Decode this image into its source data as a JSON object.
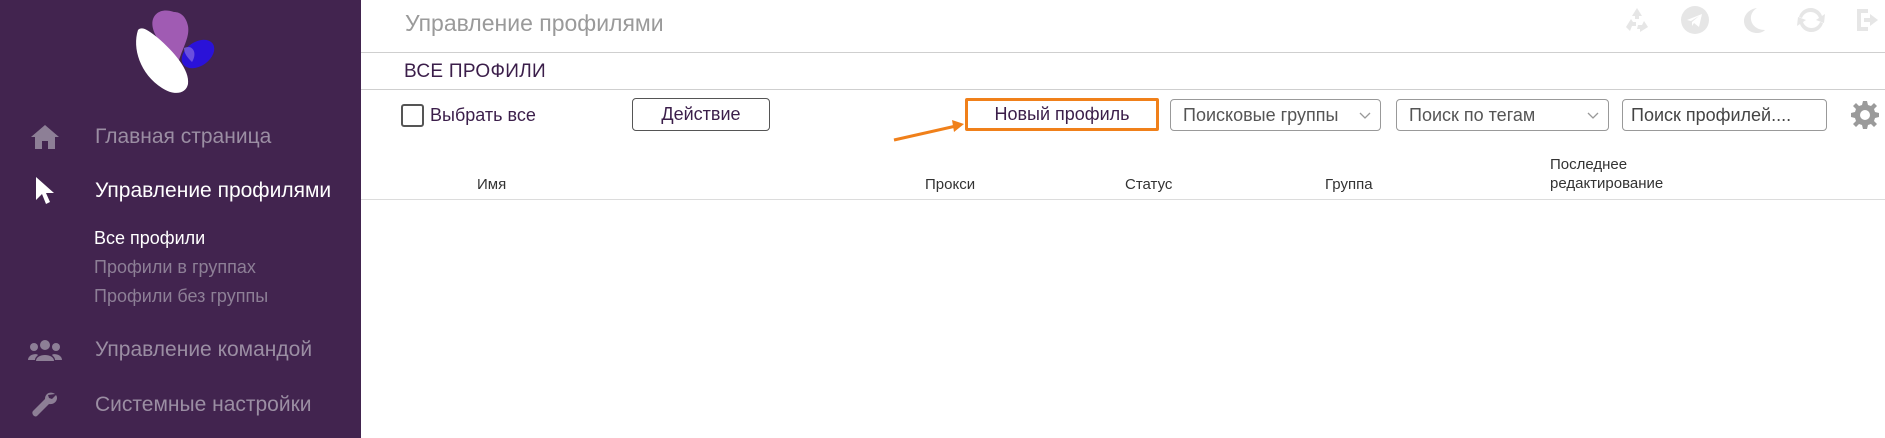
{
  "sidebar": {
    "nav": [
      {
        "label": "Главная страница",
        "icon": "home-icon",
        "active": false
      },
      {
        "label": "Управление профилями",
        "icon": "cursor-icon",
        "active": true
      },
      {
        "label": "Управление командой",
        "icon": "users-icon",
        "active": false
      },
      {
        "label": "Системные настройки",
        "icon": "wrench-icon",
        "active": false
      }
    ],
    "sub_items": [
      {
        "label": "Все профили",
        "active": true
      },
      {
        "label": "Профили в группах",
        "active": false
      },
      {
        "label": "Профили без группы",
        "active": false
      }
    ]
  },
  "header": {
    "title": "Управление профилями",
    "icons": [
      "recycle-icon",
      "telegram-icon",
      "moon-icon",
      "refresh-icon",
      "logout-icon"
    ]
  },
  "section": {
    "title": "ВСЕ ПРОФИЛИ"
  },
  "toolbar": {
    "select_all_label": "Выбрать все",
    "action_label": "Действие",
    "new_profile_label": "Новый профиль",
    "groups_dropdown": "Поисковые группы",
    "tags_dropdown": "Поиск по тегам",
    "search_placeholder": "Поиск профилей...."
  },
  "table": {
    "columns": [
      "Имя",
      "Прокси",
      "Статус",
      "Группа",
      "Последнее",
      "редактирование"
    ]
  },
  "colors": {
    "sidebar_bg": "#42244f",
    "highlight": "#f0801a",
    "text_dark": "#3b1e4a"
  }
}
